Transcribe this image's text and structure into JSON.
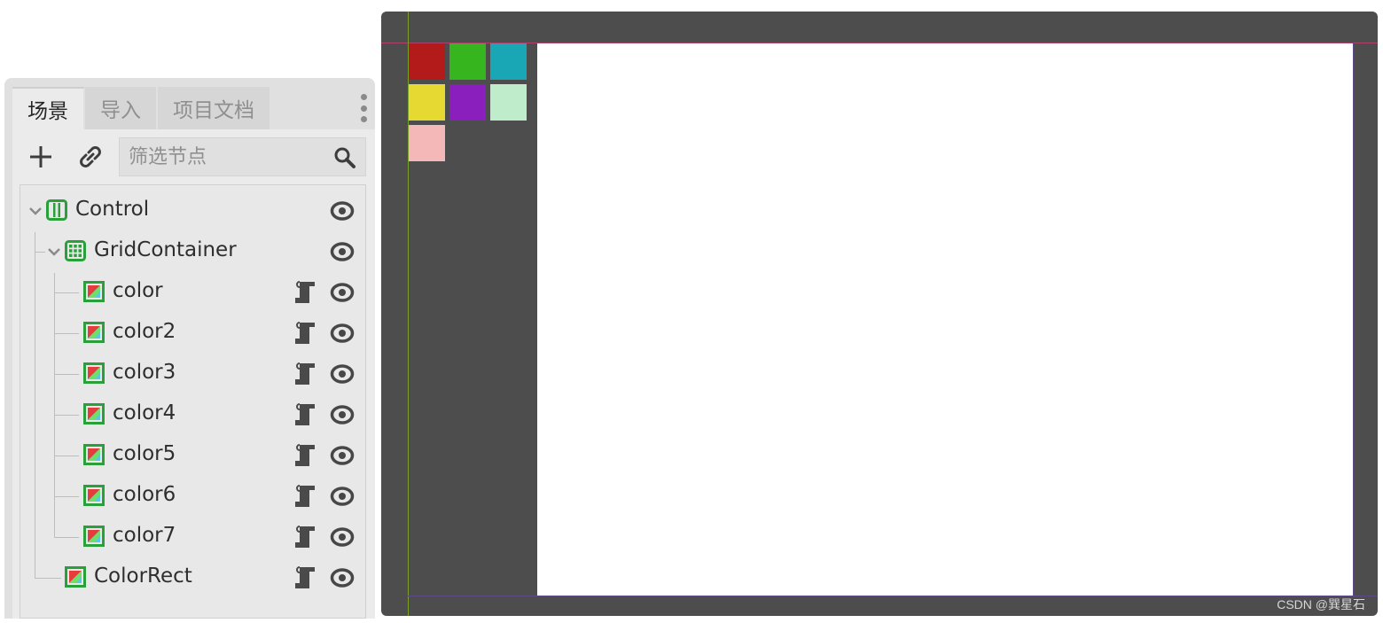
{
  "dock": {
    "tabs": [
      {
        "label": "场景",
        "active": true
      },
      {
        "label": "导入",
        "active": false
      },
      {
        "label": "项目文档",
        "active": false
      }
    ],
    "toolbar": {
      "add_icon": "plus-icon",
      "link_icon": "link-icon",
      "filter_placeholder": "筛选节点",
      "search_icon": "search-icon"
    },
    "tree": [
      {
        "name": "Control",
        "icon": "control-node-icon",
        "depth": 0,
        "expanded": true,
        "script": false
      },
      {
        "name": "GridContainer",
        "icon": "grid-container-icon",
        "depth": 1,
        "expanded": true,
        "script": false
      },
      {
        "name": "color",
        "icon": "colorrect-icon",
        "depth": 2,
        "script": true
      },
      {
        "name": "color2",
        "icon": "colorrect-icon",
        "depth": 2,
        "script": true
      },
      {
        "name": "color3",
        "icon": "colorrect-icon",
        "depth": 2,
        "script": true
      },
      {
        "name": "color4",
        "icon": "colorrect-icon",
        "depth": 2,
        "script": true
      },
      {
        "name": "color5",
        "icon": "colorrect-icon",
        "depth": 2,
        "script": true
      },
      {
        "name": "color6",
        "icon": "colorrect-icon",
        "depth": 2,
        "script": true
      },
      {
        "name": "color7",
        "icon": "colorrect-icon",
        "depth": 2,
        "script": true
      },
      {
        "name": "ColorRect",
        "icon": "colorrect-icon",
        "depth": 1,
        "script": true
      }
    ]
  },
  "viewport": {
    "swatch_colors": [
      "#b31b1b",
      "#36b51f",
      "#1aa7b5",
      "#e5d932",
      "#8b1fbd",
      "#bfedcb",
      "#f5b8b8"
    ],
    "grid_columns": 3
  },
  "watermark": "CSDN @巽星石",
  "colors": {
    "node_green": "#2aa03a",
    "icon_dark": "#4a4a4a",
    "viewport_bg": "#4d4d4d"
  }
}
